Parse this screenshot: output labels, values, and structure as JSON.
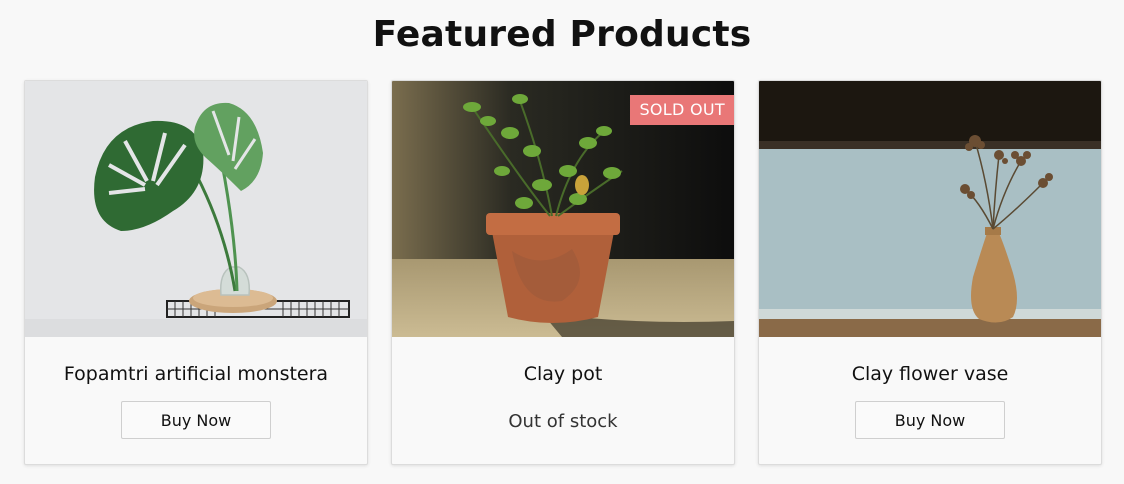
{
  "header": {
    "title": "Featured Products"
  },
  "products": [
    {
      "name": "Fopamtri artificial monstera",
      "image_icon": "monstera-plant-image",
      "button_label": "Buy Now"
    },
    {
      "name": "Clay pot",
      "image_icon": "clay-pot-plant-image",
      "badge": "SOLD OUT",
      "stock_status": "Out of stock"
    },
    {
      "name": "Clay flower vase",
      "image_icon": "flower-vase-image",
      "button_label": "Buy Now"
    }
  ],
  "colors": {
    "badge_bg": "#e97777",
    "page_bg": "#f8f8f8"
  }
}
